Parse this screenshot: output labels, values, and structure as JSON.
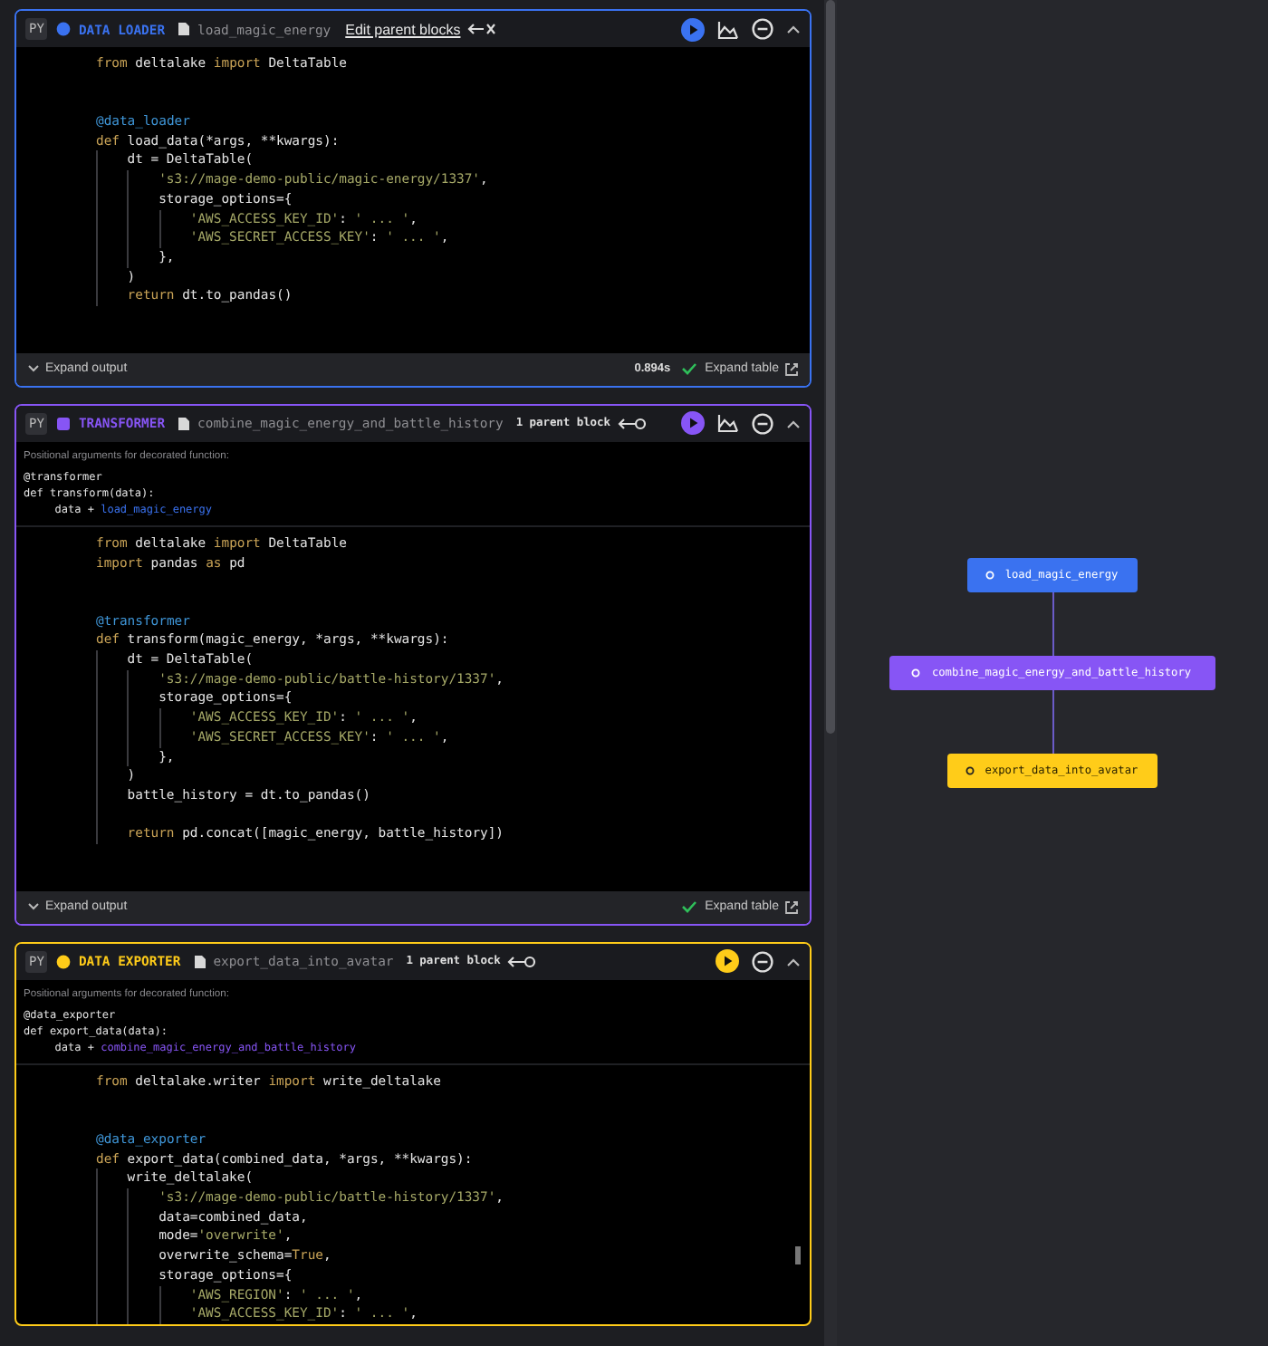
{
  "blocks": [
    {
      "kind": "loader",
      "language": "PY",
      "type_label": "DATA LOADER",
      "file": "load_magic_energy",
      "parent": {
        "kind": "edit_link",
        "text": "Edit parent blocks"
      },
      "chart_button": true,
      "code": [
        {
          "kind": "code",
          "tokens": [
            {
              "kind": "keyword",
              "text": "from"
            },
            {
              "kind": "plain",
              "text": " deltalake "
            },
            {
              "kind": "keyword",
              "text": "import"
            },
            {
              "kind": "plain",
              "text": " DeltaTable"
            }
          ]
        },
        {
          "kind": "blank"
        },
        {
          "kind": "blank"
        },
        {
          "kind": "code",
          "tokens": [
            {
              "kind": "decorator",
              "text": "@data_loader"
            }
          ]
        },
        {
          "kind": "code",
          "tokens": [
            {
              "kind": "keyword",
              "text": "def"
            },
            {
              "kind": "plain",
              "text": " load_data(*args, **kwargs):"
            }
          ]
        },
        {
          "kind": "code",
          "tokens": [
            {
              "kind": "plain",
              "text": "    dt = DeltaTable("
            }
          ]
        },
        {
          "kind": "code",
          "tokens": [
            {
              "kind": "string",
              "text": "        's3://mage-demo-public/magic-energy/1337'"
            },
            {
              "kind": "plain",
              "text": ","
            }
          ]
        },
        {
          "kind": "code",
          "tokens": [
            {
              "kind": "plain",
              "text": "        storage_options={"
            }
          ]
        },
        {
          "kind": "code",
          "tokens": [
            {
              "kind": "string",
              "text": "            'AWS_ACCESS_KEY_ID'"
            },
            {
              "kind": "plain",
              "text": ": "
            },
            {
              "kind": "string",
              "text": "' ... '"
            },
            {
              "kind": "plain",
              "text": ","
            }
          ]
        },
        {
          "kind": "code",
          "tokens": [
            {
              "kind": "string",
              "text": "            'AWS_SECRET_ACCESS_KEY'"
            },
            {
              "kind": "plain",
              "text": ": "
            },
            {
              "kind": "string",
              "text": "' ... '"
            },
            {
              "kind": "plain",
              "text": ","
            }
          ]
        },
        {
          "kind": "code",
          "tokens": [
            {
              "kind": "plain",
              "text": "        },"
            }
          ]
        },
        {
          "kind": "code",
          "tokens": [
            {
              "kind": "plain",
              "text": "    )"
            }
          ]
        },
        {
          "kind": "code",
          "tokens": [
            {
              "kind": "keyword",
              "text": "    return"
            },
            {
              "kind": "plain",
              "text": " dt.to_pandas()"
            }
          ]
        }
      ],
      "footer": {
        "expand_output": "Expand output",
        "runtime": "0.894s",
        "expand_table": "Expand table"
      }
    },
    {
      "kind": "transformer",
      "language": "PY",
      "type_label": "TRANSFORMER",
      "file": "combine_magic_energy_and_battle_history",
      "parent": {
        "kind": "count",
        "text": "1 parent block"
      },
      "chart_button": true,
      "args": {
        "caption": "Positional arguments for decorated function:",
        "lines": [
          [
            {
              "kind": "plain",
              "text": "@transformer"
            }
          ],
          [
            {
              "kind": "plain",
              "text": "def transform(data):"
            }
          ],
          [
            {
              "kind": "plain",
              "text": "    data + "
            },
            {
              "kind": "link",
              "text": "load_magic_energy"
            }
          ]
        ]
      },
      "code": [
        {
          "kind": "code",
          "tokens": [
            {
              "kind": "keyword",
              "text": "from"
            },
            {
              "kind": "plain",
              "text": " deltalake "
            },
            {
              "kind": "keyword",
              "text": "import"
            },
            {
              "kind": "plain",
              "text": " DeltaTable"
            }
          ]
        },
        {
          "kind": "code",
          "tokens": [
            {
              "kind": "keyword",
              "text": "import"
            },
            {
              "kind": "plain",
              "text": " pandas "
            },
            {
              "kind": "keyword",
              "text": "as"
            },
            {
              "kind": "plain",
              "text": " pd"
            }
          ]
        },
        {
          "kind": "blank"
        },
        {
          "kind": "blank"
        },
        {
          "kind": "code",
          "tokens": [
            {
              "kind": "decorator",
              "text": "@transformer"
            }
          ]
        },
        {
          "kind": "code",
          "tokens": [
            {
              "kind": "keyword",
              "text": "def"
            },
            {
              "kind": "plain",
              "text": " transform(magic_energy, *args, **kwargs):"
            }
          ]
        },
        {
          "kind": "code",
          "tokens": [
            {
              "kind": "plain",
              "text": "    dt = DeltaTable("
            }
          ]
        },
        {
          "kind": "code",
          "tokens": [
            {
              "kind": "string",
              "text": "        's3://mage-demo-public/battle-history/1337'"
            },
            {
              "kind": "plain",
              "text": ","
            }
          ]
        },
        {
          "kind": "code",
          "tokens": [
            {
              "kind": "plain",
              "text": "        storage_options={"
            }
          ]
        },
        {
          "kind": "code",
          "tokens": [
            {
              "kind": "string",
              "text": "            'AWS_ACCESS_KEY_ID'"
            },
            {
              "kind": "plain",
              "text": ": "
            },
            {
              "kind": "string",
              "text": "' ... '"
            },
            {
              "kind": "plain",
              "text": ","
            }
          ]
        },
        {
          "kind": "code",
          "tokens": [
            {
              "kind": "string",
              "text": "            'AWS_SECRET_ACCESS_KEY'"
            },
            {
              "kind": "plain",
              "text": ": "
            },
            {
              "kind": "string",
              "text": "' ... '"
            },
            {
              "kind": "plain",
              "text": ","
            }
          ]
        },
        {
          "kind": "code",
          "tokens": [
            {
              "kind": "plain",
              "text": "        },"
            }
          ]
        },
        {
          "kind": "code",
          "tokens": [
            {
              "kind": "plain",
              "text": "    )"
            }
          ]
        },
        {
          "kind": "code",
          "tokens": [
            {
              "kind": "plain",
              "text": "    battle_history = dt.to_pandas()"
            }
          ]
        },
        {
          "kind": "guide"
        },
        {
          "kind": "code",
          "tokens": [
            {
              "kind": "keyword",
              "text": "    return"
            },
            {
              "kind": "plain",
              "text": " pd.concat([magic_energy, battle_history])"
            }
          ]
        }
      ],
      "footer": {
        "expand_output": "Expand output",
        "expand_table": "Expand table"
      }
    },
    {
      "kind": "exporter",
      "language": "PY",
      "type_label": "DATA EXPORTER",
      "file": "export_data_into_avatar",
      "parent": {
        "kind": "count",
        "text": "1 parent block"
      },
      "chart_button": false,
      "args": {
        "caption": "Positional arguments for decorated function:",
        "lines": [
          [
            {
              "kind": "plain",
              "text": "@data_exporter"
            }
          ],
          [
            {
              "kind": "plain",
              "text": "def export_data(data):"
            }
          ],
          [
            {
              "kind": "plain",
              "text": "    data + "
            },
            {
              "kind": "link",
              "text": "combine_magic_energy_and_battle_history"
            }
          ]
        ]
      },
      "code": [
        {
          "kind": "code",
          "tokens": [
            {
              "kind": "keyword",
              "text": "from"
            },
            {
              "kind": "plain",
              "text": " deltalake.writer "
            },
            {
              "kind": "keyword",
              "text": "import"
            },
            {
              "kind": "plain",
              "text": " write_deltalake"
            }
          ]
        },
        {
          "kind": "blank"
        },
        {
          "kind": "blank"
        },
        {
          "kind": "code",
          "tokens": [
            {
              "kind": "decorator",
              "text": "@data_exporter"
            }
          ]
        },
        {
          "kind": "code",
          "tokens": [
            {
              "kind": "keyword",
              "text": "def"
            },
            {
              "kind": "plain",
              "text": " export_data(combined_data, *args, **kwargs):"
            }
          ]
        },
        {
          "kind": "code",
          "tokens": [
            {
              "kind": "plain",
              "text": "    write_deltalake("
            }
          ]
        },
        {
          "kind": "code",
          "tokens": [
            {
              "kind": "string",
              "text": "        's3://mage-demo-public/battle-history/1337'"
            },
            {
              "kind": "plain",
              "text": ","
            }
          ]
        },
        {
          "kind": "code",
          "tokens": [
            {
              "kind": "plain",
              "text": "        data=combined_data,"
            }
          ]
        },
        {
          "kind": "code",
          "tokens": [
            {
              "kind": "plain",
              "text": "        mode="
            },
            {
              "kind": "string",
              "text": "'overwrite'"
            },
            {
              "kind": "plain",
              "text": ","
            }
          ]
        },
        {
          "kind": "code",
          "tokens": [
            {
              "kind": "plain",
              "text": "        overwrite_schema="
            },
            {
              "kind": "keyword",
              "text": "True"
            },
            {
              "kind": "plain",
              "text": ","
            }
          ]
        },
        {
          "kind": "code",
          "tokens": [
            {
              "kind": "plain",
              "text": "        storage_options={"
            }
          ]
        },
        {
          "kind": "code",
          "tokens": [
            {
              "kind": "string",
              "text": "            'AWS_REGION'"
            },
            {
              "kind": "plain",
              "text": ": "
            },
            {
              "kind": "string",
              "text": "' ... '"
            },
            {
              "kind": "plain",
              "text": ","
            }
          ]
        },
        {
          "kind": "code",
          "tokens": [
            {
              "kind": "string",
              "text": "            'AWS_ACCESS_KEY_ID'"
            },
            {
              "kind": "plain",
              "text": ": "
            },
            {
              "kind": "string",
              "text": "' ... '"
            },
            {
              "kind": "plain",
              "text": ","
            }
          ]
        }
      ]
    }
  ],
  "graph": {
    "nodes": [
      {
        "kind": "loader",
        "label": "load_magic_energy"
      },
      {
        "kind": "transformer",
        "label": "combine_magic_energy_and_battle_history"
      },
      {
        "kind": "exporter",
        "label": "export_data_into_avatar"
      }
    ]
  }
}
